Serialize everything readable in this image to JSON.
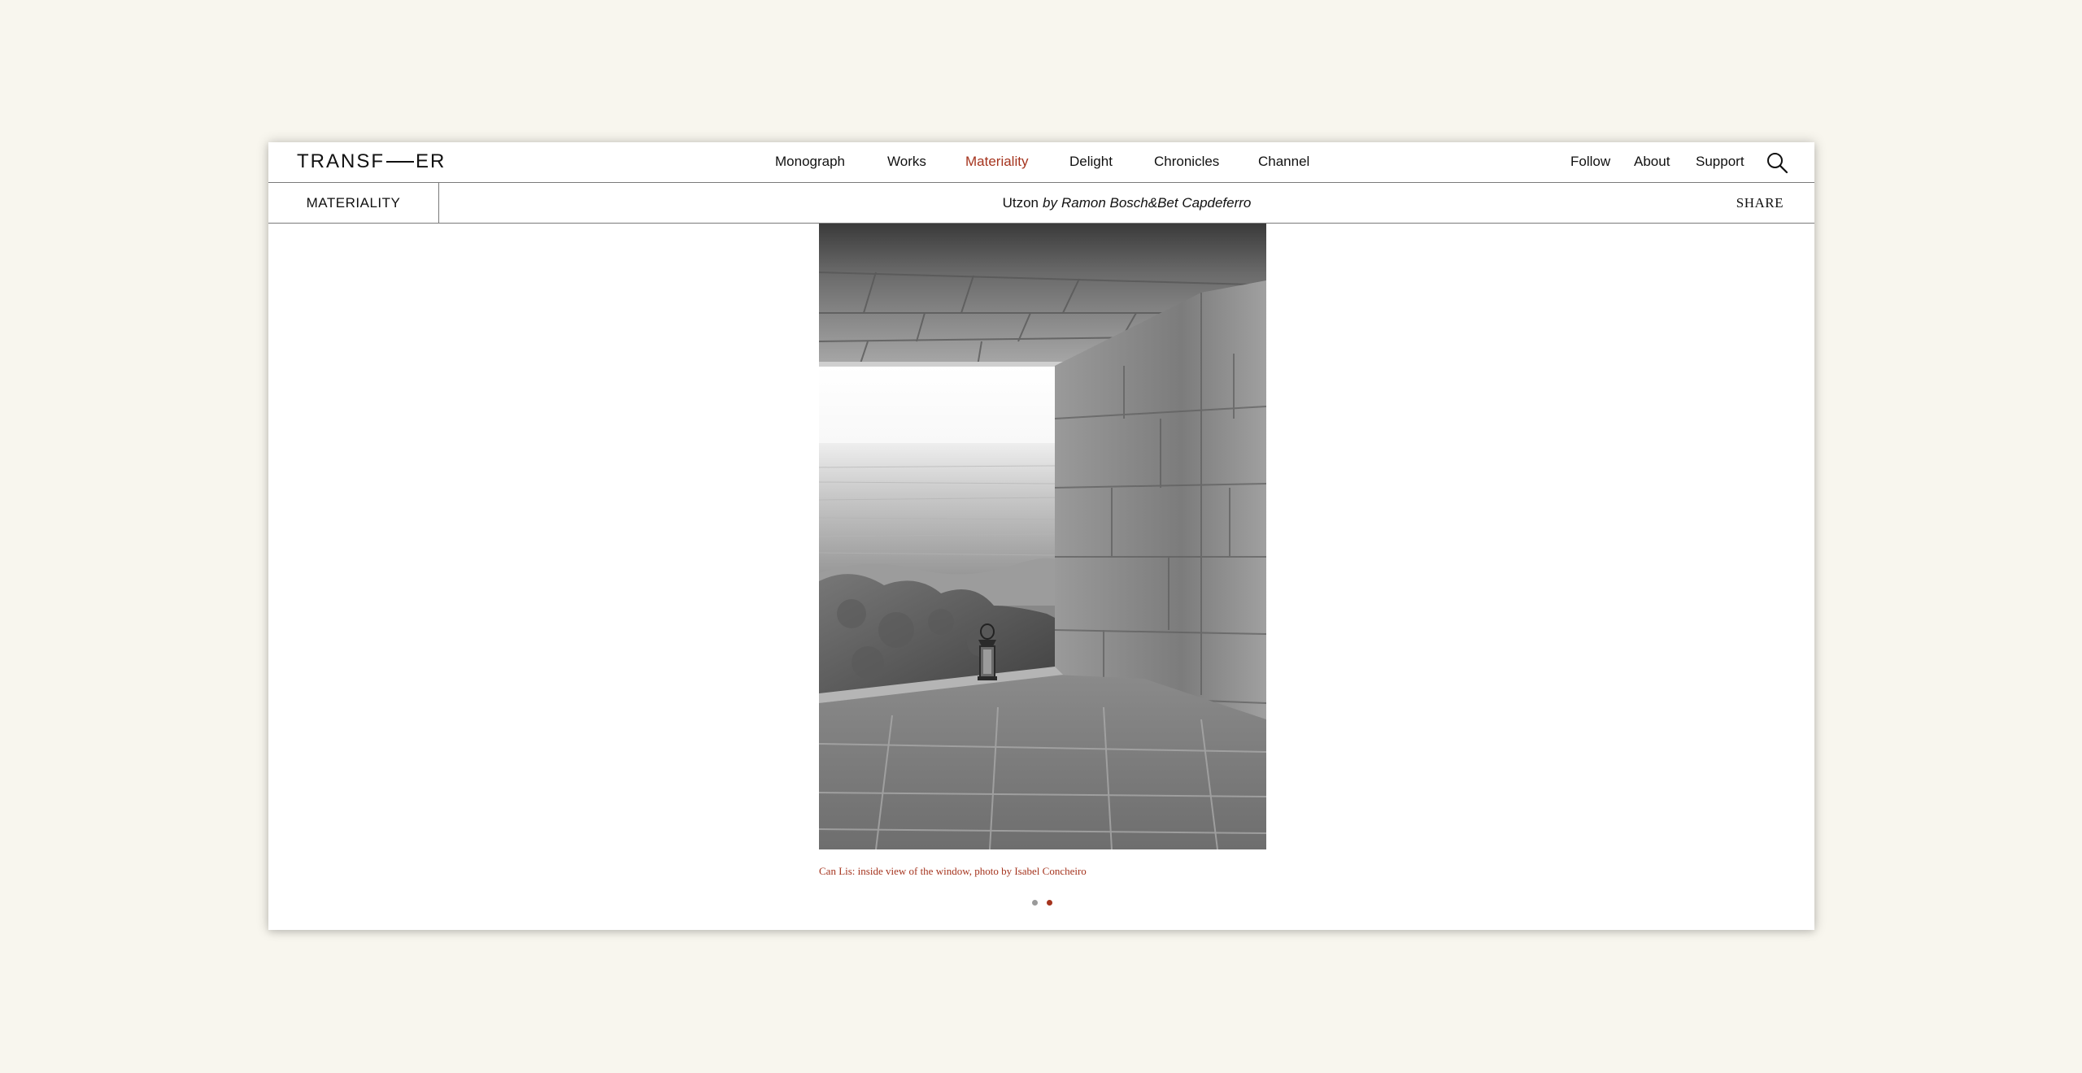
{
  "header": {
    "logo_left": "TRANSF",
    "logo_right": "ER",
    "nav": [
      {
        "label": "Monograph",
        "active": false
      },
      {
        "label": "Works",
        "active": false
      },
      {
        "label": "Materiality",
        "active": true
      },
      {
        "label": "Delight",
        "active": false
      },
      {
        "label": "Chronicles",
        "active": false
      },
      {
        "label": "Channel",
        "active": false
      }
    ],
    "secondary_nav": [
      {
        "label": "Follow"
      },
      {
        "label": "About"
      },
      {
        "label": "Support"
      }
    ],
    "search_icon": "search-icon"
  },
  "subheader": {
    "section": "MATERIALITY",
    "title": "Utzon",
    "by": "by",
    "authors": "Ramon Bosch&Bet Capdeferro",
    "share_label": "SHARE"
  },
  "slide": {
    "caption": "Can Lis: inside view of the window, photo by Isabel Concheiro",
    "total": 2,
    "current": 2
  },
  "colors": {
    "accent": "#a5341e",
    "page_background": "#f8f6ee",
    "frame_background": "#ffffff"
  }
}
